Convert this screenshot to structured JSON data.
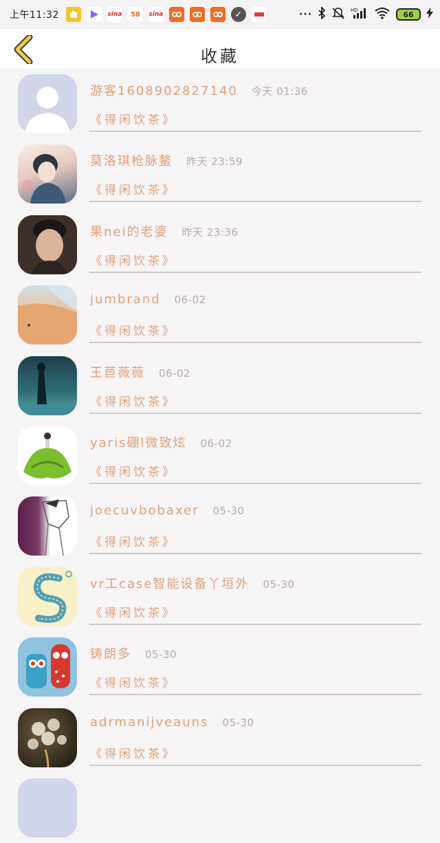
{
  "status_bar": {
    "time": "上午11:32",
    "icons": [
      {
        "name": "yellow-app",
        "text": "",
        "color": "#f6c423"
      },
      {
        "name": "play",
        "text": "▶",
        "color": "#ffffff"
      },
      {
        "name": "sina",
        "text": "sina",
        "color": "#ffffff"
      },
      {
        "name": "58",
        "text": "58",
        "color": "#ffffff"
      },
      {
        "name": "sina2",
        "text": "sina",
        "color": "#ffffff"
      },
      {
        "name": "taobao1",
        "text": "",
        "color": "#f26b21"
      },
      {
        "name": "taobao2",
        "text": "",
        "color": "#f26b21"
      },
      {
        "name": "taobao3",
        "text": "",
        "color": "#f26b21"
      },
      {
        "name": "check",
        "text": "✓",
        "color": "#444444"
      },
      {
        "name": "news",
        "text": "",
        "color": "#ffffff"
      }
    ],
    "more": "···",
    "battery": "66"
  },
  "header": {
    "title": "收藏"
  },
  "tag_text": "《得闲饮茶》",
  "rows": [
    {
      "name": "游客1608902827140",
      "time": "今天 01:36",
      "avatar": "default"
    },
    {
      "name": "莫洛琪枪脉鳌",
      "time": "昨天 23:59",
      "avatar": "anime-boy"
    },
    {
      "name": "果nei的老婆",
      "time": "昨天 23:36",
      "avatar": "man-portrait"
    },
    {
      "name": "jumbrand",
      "time": "06-02",
      "avatar": "beach"
    },
    {
      "name": "王苣薇薇",
      "time": "06-02",
      "avatar": "dark-teal"
    },
    {
      "name": "yaris硼l微致炫",
      "time": "06-02",
      "avatar": "green-dress"
    },
    {
      "name": "joecuvbobaxer",
      "time": "05-30",
      "avatar": "sketch"
    },
    {
      "name": "vr工case智能设备丫垣外",
      "time": "05-30",
      "avatar": "letter-s"
    },
    {
      "name": "铸朗多",
      "time": "05-30",
      "avatar": "toys"
    },
    {
      "name": "adrmanijveauns",
      "time": "05-30",
      "avatar": "dandelion"
    }
  ],
  "colors": {
    "accent": "#e0a27d",
    "time": "#b5b0b0",
    "divider": "#cfcbcb",
    "back_arrow": "#f2c94c"
  }
}
